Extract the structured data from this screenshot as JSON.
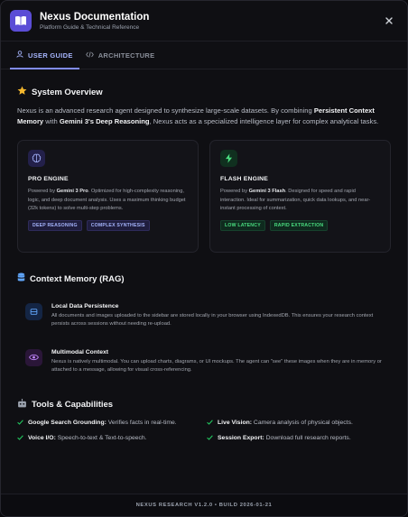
{
  "header": {
    "title": "Nexus Documentation",
    "subtitle": "Platform Guide & Technical Reference",
    "logo_icon": "book-icon",
    "close_icon": "close-icon"
  },
  "tabs": [
    {
      "label": "USER GUIDE",
      "icon": "user-icon",
      "active": true
    },
    {
      "label": "ARCHITECTURE",
      "icon": "code-icon",
      "active": false
    }
  ],
  "overview": {
    "title": "System Overview",
    "icon": "star-icon",
    "intro_1": "Nexus is an advanced research agent designed to synthesize large-scale datasets. By combining ",
    "intro_bold_1": "Persistent Context Memory",
    "intro_2": " with ",
    "intro_bold_2": "Gemini 3's Deep Reasoning",
    "intro_3": ", Nexus acts as a specialized intelligence layer for complex analytical tasks."
  },
  "engines": [
    {
      "name": "PRO ENGINE",
      "icon": "brain-icon",
      "desc_1": "Powered by ",
      "desc_bold": "Gemini 3 Pro",
      "desc_2": ". Optimized for high-complexity reasoning, logic, and deep document analysis. Uses a maximum thinking budget (32k tokens) to solve multi-step problems.",
      "tags": [
        "DEEP REASONING",
        "COMPLEX SYNTHESIS"
      ]
    },
    {
      "name": "FLASH ENGINE",
      "icon": "lightning-icon",
      "desc_1": "Powered by ",
      "desc_bold": "Gemini 3 Flash",
      "desc_2": ". Designed for speed and rapid interaction. Ideal for summarization, quick data lookups, and near-instant processing of context.",
      "tags": [
        "LOW LATENCY",
        "RAPID EXTRACTION"
      ]
    }
  ],
  "memory": {
    "title": "Context Memory (RAG)",
    "icon": "database-icon",
    "items": [
      {
        "title": "Local Data Persistence",
        "icon": "storage-icon",
        "desc": "All documents and images uploaded to the sidebar are stored locally in your browser using IndexedDB. This ensures your research context persists across sessions without needing re-upload."
      },
      {
        "title": "Multimodal Context",
        "icon": "eye-icon",
        "desc": "Nexus is natively multimodal. You can upload charts, diagrams, or UI mockups. The agent can \"see\" these images when they are in memory or attached to a message, allowing for visual cross-referencing."
      }
    ]
  },
  "tools": {
    "title": "Tools & Capabilities",
    "icon": "robot-icon",
    "items": [
      {
        "bold": "Google Search Grounding:",
        "text": " Verifies facts in real-time."
      },
      {
        "bold": "Live Vision:",
        "text": " Camera analysis of physical objects."
      },
      {
        "bold": "Voice I/O:",
        "text": " Speech-to-text & Text-to-speech."
      },
      {
        "bold": "Session Export:",
        "text": " Download full research reports."
      }
    ]
  },
  "footer": {
    "text": "NEXUS RESEARCH V1.2.0 • BUILD 2026-01-21"
  },
  "colors": {
    "accent": "#818cf8",
    "logo_bg": "#5b4dd6",
    "check_green": "#22c55e",
    "star_yellow": "#f5b82e"
  }
}
